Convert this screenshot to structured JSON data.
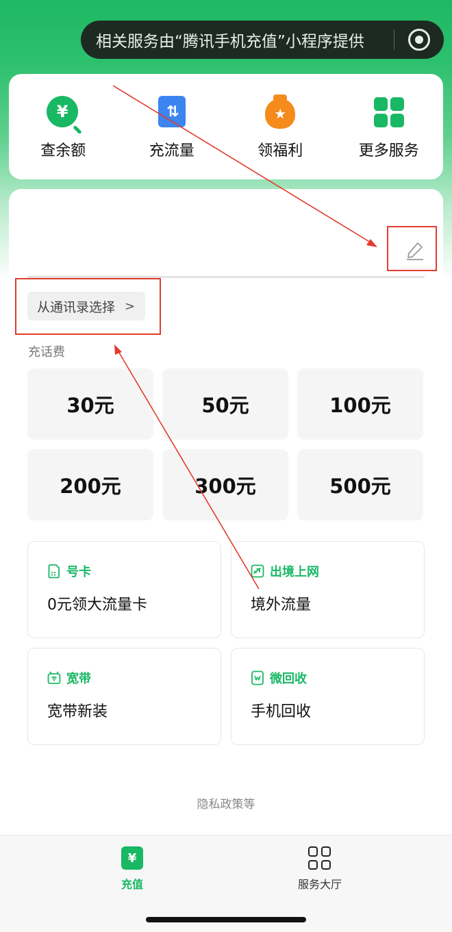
{
  "banner": {
    "text": "相关服务由“腾讯手机充值”小程序提供",
    "icon": "target-icon"
  },
  "quick_actions": [
    {
      "label": "查余额",
      "icon": "balance-icon",
      "glyph": "¥"
    },
    {
      "label": "充流量",
      "icon": "data-flow-icon",
      "glyph": "⇅"
    },
    {
      "label": "领福利",
      "icon": "gift-bag-icon",
      "glyph": "★"
    },
    {
      "label": "更多服务",
      "icon": "grid-icon"
    }
  ],
  "phone_input": {
    "value": "",
    "placeholder": ""
  },
  "contacts_button": {
    "label": "从通讯录选择",
    "chevron": ">"
  },
  "recharge_section": {
    "title": "充话费",
    "amounts": [
      "30元",
      "50元",
      "100元",
      "200元",
      "300元",
      "500元"
    ]
  },
  "services": [
    {
      "tag": "号卡",
      "title": "0元领大流量卡",
      "icon": "sim-card-icon"
    },
    {
      "tag": "出境上网",
      "title": "境外流量",
      "icon": "airplane-icon"
    },
    {
      "tag": "宽带",
      "title": "宽带新装",
      "icon": "router-icon"
    },
    {
      "tag": "微回收",
      "title": "手机回收",
      "icon": "recycle-phone-icon"
    }
  ],
  "privacy_text": "隐私政策等",
  "tabbar": {
    "recharge_label": "充值",
    "recharge_glyph": "¥",
    "hall_label": "服务大厅"
  },
  "colors": {
    "brand_green": "#19b865",
    "annotation_red": "#e23b2e",
    "banner_bg": "#1d2a22"
  }
}
